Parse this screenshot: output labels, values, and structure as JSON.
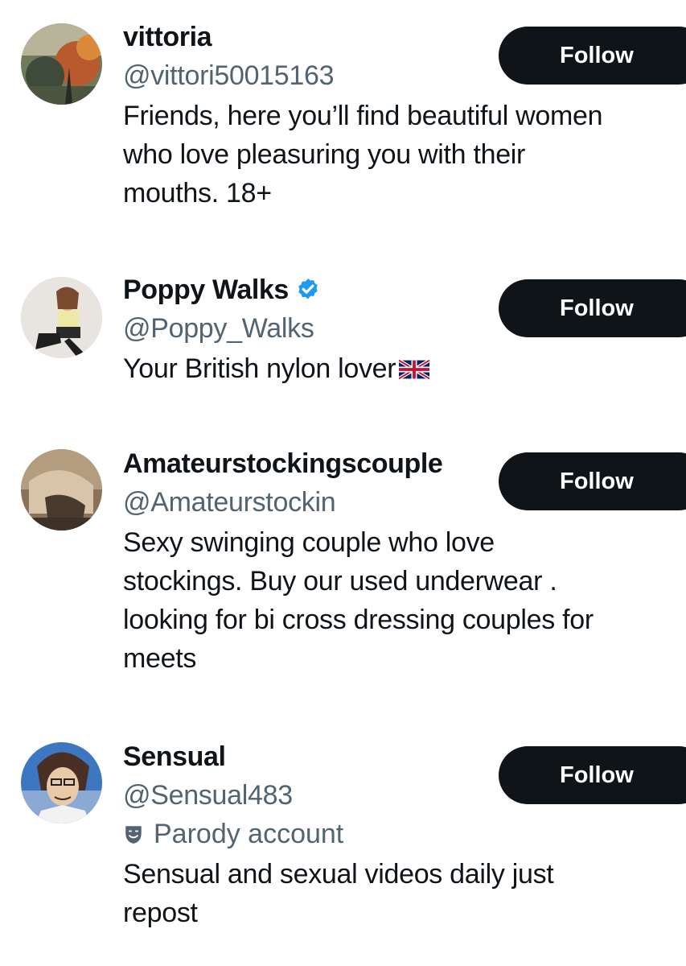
{
  "accounts": [
    {
      "display_name": "vittoria",
      "handle": "@vittori50015163",
      "verified": false,
      "label": "",
      "bio_lines": [
        "Friends, here you’ll find beautiful women",
        "who love pleasuring you with their",
        "mouths. 18+"
      ],
      "follow_label": "Follow"
    },
    {
      "display_name": "Poppy Walks",
      "handle": "@Poppy_Walks",
      "verified": true,
      "label": "",
      "bio_lines": [
        "Your British nylon lover"
      ],
      "bio_emoji": "uk-flag-icon",
      "follow_label": "Follow"
    },
    {
      "display_name": "Amateurstockingscouple",
      "handle": "@Amateurstockin",
      "verified": false,
      "label": "",
      "bio_lines": [
        "Sexy swinging couple who love",
        "stockings. Buy our used underwear .",
        "looking for bi cross dressing couples for",
        "meets"
      ],
      "follow_label": "Follow"
    },
    {
      "display_name": "Sensual",
      "handle": "@Sensual483",
      "verified": false,
      "label": "Parody account",
      "label_icon": "theater-masks-icon",
      "bio_lines": [
        "Sensual and sexual videos daily just",
        "repost"
      ],
      "follow_label": "Follow"
    }
  ],
  "colors": {
    "text_primary": "#0f1419",
    "text_secondary": "#536471",
    "button_bg": "#0f1419",
    "button_text": "#ffffff",
    "verified_blue": "#1d9bf0"
  }
}
